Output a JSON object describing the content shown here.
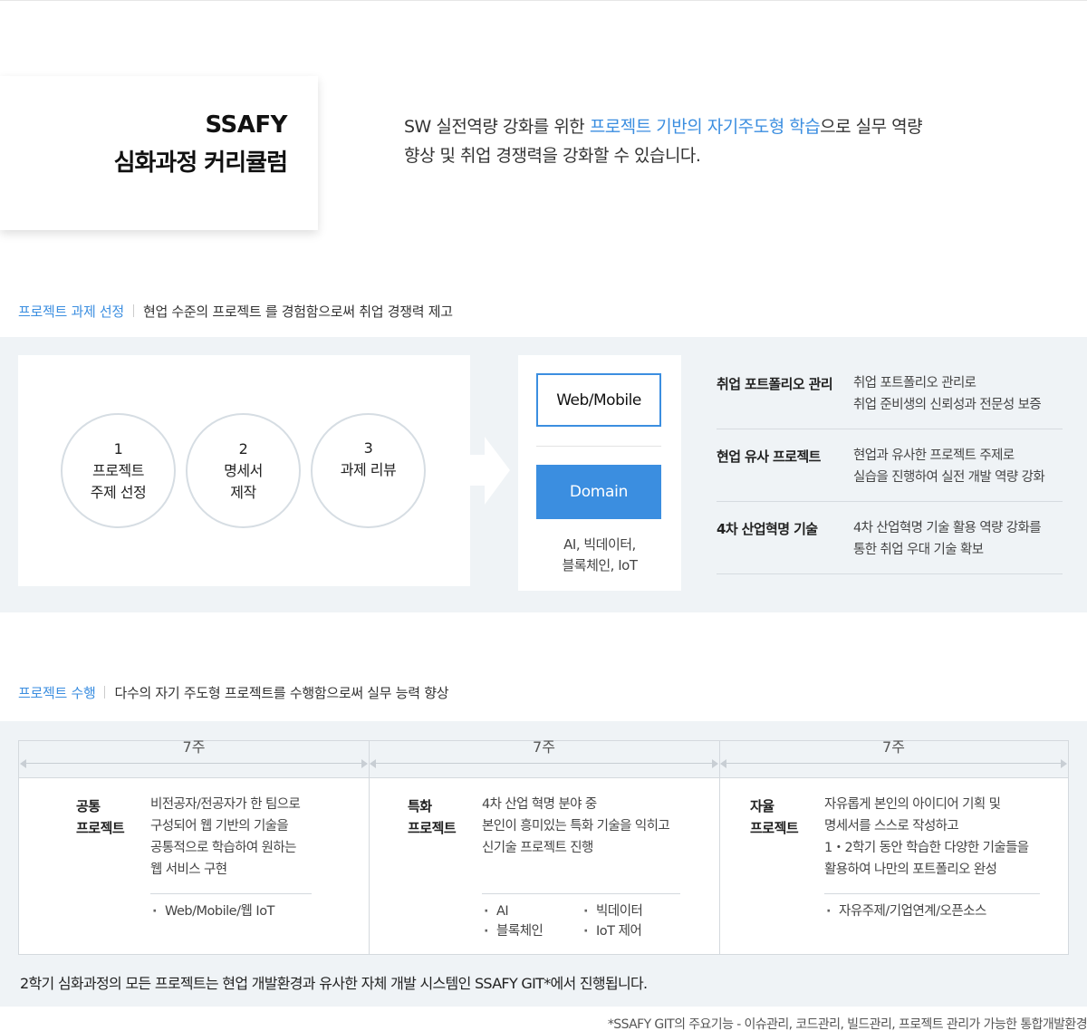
{
  "header": {
    "title_line1": "SSAFY",
    "title_line2": "심화과정 커리큘럼",
    "intro_part1": "SW 실전역량 강화를 위한 ",
    "intro_highlight": "프로젝트 기반의 자기주도형 학습",
    "intro_part2": "으로  실무 역량",
    "intro_line2": "향상 및 취업 경쟁력을 강화할 수 있습니다."
  },
  "section1": {
    "label": "프로젝트 과제 선정",
    "description": "현업 수준의 프로젝트 를 경험함으로써 취업 경쟁력 제고",
    "steps": [
      {
        "num": "1",
        "line1": "프로젝트",
        "line2": "주제 선정"
      },
      {
        "num": "2",
        "line1": "명세서",
        "line2": "제작"
      },
      {
        "num": "3",
        "line1": "과제 리뷰",
        "line2": ""
      }
    ],
    "web_mobile_label": "Web/Mobile",
    "domain_label": "Domain",
    "domain_desc_line1": "AI, 빅데이터,",
    "domain_desc_line2": "블록체인, IoT",
    "features": [
      {
        "title": "취업 포트폴리오 관리",
        "desc1": "취업 포트폴리오 관리로",
        "desc2": "취업 준비생의 신뢰성과 전문성 보증"
      },
      {
        "title": "현업 유사 프로젝트",
        "desc1": "현업과 유사한 프로젝트 주제로",
        "desc2": "실습을 진행하여 실전 개발 역량 강화"
      },
      {
        "title": "4차 산업혁명 기술",
        "desc1": "4차 산업혁명 기술 활용 역량 강화를",
        "desc2": "통한 취업 우대 기술 확보"
      }
    ]
  },
  "section2": {
    "label": "프로젝트 수행",
    "description": "다수의 자기 주도형 프로젝트를 수행함으로써 실무 능력 향상",
    "columns": [
      {
        "weeks": "7주",
        "title1": "공통",
        "title2": "프로젝트",
        "desc": [
          "비전공자/전공자가 한 팀으로",
          "구성되어 웹 기반의 기술을",
          "공통적으로 학습하여 원하는",
          "웹 서비스 구현"
        ],
        "tags_left": [
          "Web/Mobile/웹 IoT"
        ],
        "tags_right": []
      },
      {
        "weeks": "7주",
        "title1": "특화",
        "title2": "프로젝트",
        "desc": [
          "4차 산업 혁명 분야 중",
          "본인이 흥미있는 특화 기술을 익히고",
          "신기술 프로젝트 진행"
        ],
        "tags_left": [
          "AI",
          "블록체인"
        ],
        "tags_right": [
          "빅데이터",
          "IoT 제어"
        ]
      },
      {
        "weeks": "7주",
        "title1": "자율",
        "title2": "프로젝트",
        "desc": [
          "자유롭게 본인의 아이디어 기획 및",
          "명세서를 스스로 작성하고",
          "1・2학기 동안 학습한 다양한 기술들을",
          "활용하여 나만의 포트폴리오 완성"
        ],
        "tags_left": [
          "자유주제/기업연계/오픈소스"
        ],
        "tags_right": []
      }
    ],
    "note": "2학기 심화과정의 모든 프로젝트는 현업 개발환경과 유사한 자체 개발 시스템인 SSAFY GIT*에서 진행됩니다.",
    "footnote": "*SSAFY GIT의 주요기능 - 이슈관리, 코드관리, 빌드관리, 프로젝트 관리가 가능한 통합개발환경"
  }
}
